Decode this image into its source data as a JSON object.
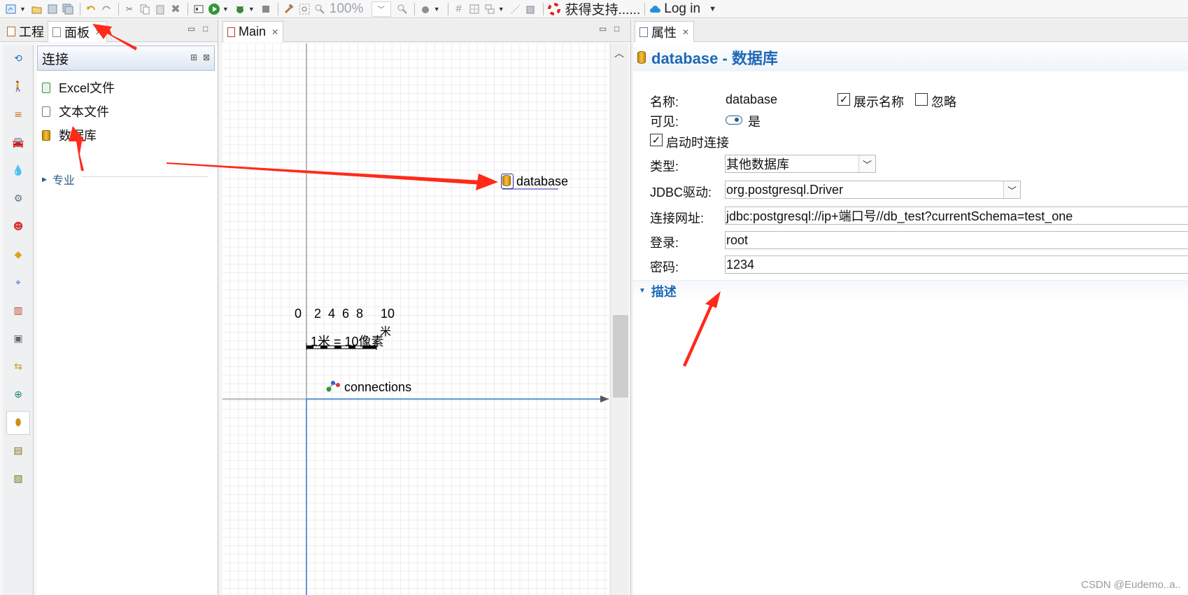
{
  "toolbar": {
    "zoom": "100%",
    "support_label": "获得支持......",
    "login_label": "Log in"
  },
  "left_panel": {
    "tabs": [
      {
        "label": "工程"
      },
      {
        "label": "面板"
      }
    ],
    "palette_header": "连接",
    "items": [
      {
        "label": "Excel文件",
        "icon": "excel-file-icon"
      },
      {
        "label": "文本文件",
        "icon": "text-file-icon"
      },
      {
        "label": "数据库",
        "icon": "database-icon"
      }
    ],
    "group": "专业",
    "category_icons": [
      "process-icon",
      "pedestrian-icon",
      "rail-icon",
      "car-icon",
      "fluid-icon",
      "material-handling-icon",
      "agent-icon",
      "presentation-icon",
      "space-markup-icon",
      "analysis-icon",
      "controls-icon",
      "connectivity-icon",
      "system-dynamics-icon",
      "connection-icon",
      "pictures-icon",
      "3d-objects-icon"
    ]
  },
  "editor": {
    "tab": "Main",
    "scale_ticks": [
      "0",
      "2",
      "4",
      "6",
      "8",
      "10"
    ],
    "scale_unit": "米",
    "scale_caption": "1米 = 10像素",
    "database_label": "database",
    "connections_label": "connections"
  },
  "properties": {
    "tab": "属性",
    "header": "database - 数据库",
    "name_label": "名称:",
    "name_value": "database",
    "show_name_label": "展示名称",
    "ignore_label": "忽略",
    "visible_label": "可见:",
    "visible_value": "是",
    "connect_on_start_label": "启动时连接",
    "type_label": "类型:",
    "type_value": "其他数据库",
    "jdbc_label": "JDBC驱动:",
    "jdbc_value": "org.postgresql.Driver",
    "url_label": "连接网址:",
    "url_value": "jdbc:postgresql://ip+端口号//db_test?currentSchema=test_one",
    "login_label": "登录:",
    "login_value": "root",
    "password_label": "密码:",
    "password_value": "1234",
    "section_description": "描述"
  },
  "watermark": "CSDN @Eudemo..a..",
  "colors": {
    "accent_blue": "#1d68b5",
    "annotation_red": "#ff2a1a",
    "database_gold": "#e6a817"
  }
}
